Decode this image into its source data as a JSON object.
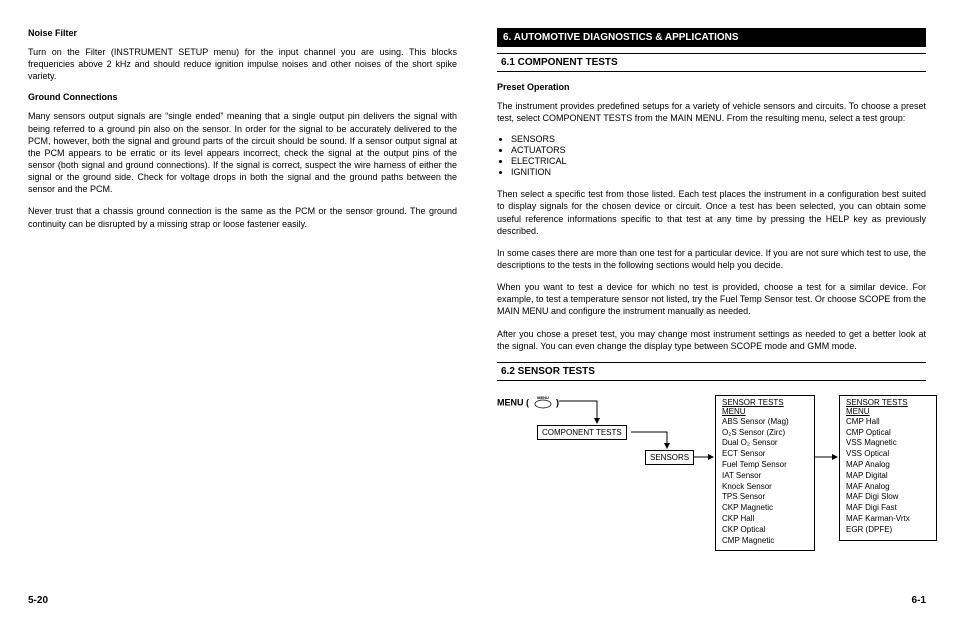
{
  "left": {
    "h1": "Noise Filter",
    "p1": "Turn on the Filter (INSTRUMENT SETUP menu) for the input channel you are using. This blocks frequencies above 2 kHz and should reduce ignition impulse noises and other noises of the short spike variety.",
    "h2": "Ground Connections",
    "p2": "Many sensors output signals are “single ended” meaning that a single output pin delivers the signal with being referred to a ground pin also on the sensor. In order for the signal to be accurately delivered to the PCM, however, both the signal and ground parts of the circuit should be sound. If a sensor output signal at the PCM appears to be erratic or its level appears incorrect, check the signal at the output pins of the sensor (both signal and ground connections). If the signal is correct, suspect the wire harness of either the signal or the ground side. Check for voltage drops in both the signal and the ground paths between the sensor and the PCM.",
    "p3": "Never trust that a chassis ground connection is the same as the PCM or the sensor ground. The ground continuity can be disrupted by a missing strap or loose fastener easily.",
    "pageNum": "5-20"
  },
  "right": {
    "bar1": "6. AUTOMOTIVE DIAGNOSTICS & APPLICATIONS",
    "bar2": "6.1 COMPONENT TESTS",
    "h1": "Preset Operation",
    "p1": "The instrument provides predefined setups for a variety of vehicle sensors and circuits. To choose a preset test, select COMPONENT TESTS from the MAIN MENU.  From the resulting menu, select a test group:",
    "bullets": [
      "SENSORS",
      "ACTUATORS",
      "ELECTRICAL",
      "IGNITION"
    ],
    "p2": "Then select a specific test from those listed. Each test places the instrument in a configuration best suited to display signals for the chosen device or circuit. Once a test has been selected, you can obtain some useful reference informations specific to that test at any time by pressing the HELP key as previously described.",
    "p3": "In some cases there are more than one test for a particular device. If you are not sure which test to use, the descriptions to the tests in the following sections would help you decide.",
    "p4": "When you want to test a device for which no test is provided, choose a test for a similar device. For example, to test a temperature sensor not listed, try the Fuel Temp Sensor test. Or choose SCOPE from the MAIN MENU and configure the instrument manually as needed.",
    "p5": "After you chose a preset test, you may change most instrument settings as needed to get a better look at the signal. You can even change the display type between SCOPE mode and GMM mode.",
    "bar3": "6.2 SENSOR TESTS",
    "diagram": {
      "menuLabel": "MENU (",
      "menuLabelEnd": ")",
      "iconText": "MENU",
      "compTests": "COMPONENT TESTS",
      "sensors": "SENSORS",
      "menu1Title": "SENSOR TESTS MENU",
      "menu1Items": [
        "ABS Sensor (Mag)",
        "O₂S Sensor (Zirc)",
        "Dual O₂ Sensor",
        "ECT Sensor",
        "Fuel Temp Sensor",
        "IAT Sensor",
        "Knock Sensor",
        "TPS Sensor",
        "CKP Magnetic",
        "CKP Hall",
        "CKP Optical",
        "CMP Magnetic"
      ],
      "menu2Title": "SENSOR TESTS MENU",
      "menu2Items": [
        "CMP Hall",
        "CMP Optical",
        "VSS Magnetic",
        "VSS Optical",
        "MAP Analog",
        "MAP Digital",
        "MAF Analog",
        "MAF Digi Slow",
        "MAF Digi Fast",
        "MAF Karman-Vrtx",
        "EGR (DPFE)"
      ]
    },
    "pageNum": "6-1"
  }
}
